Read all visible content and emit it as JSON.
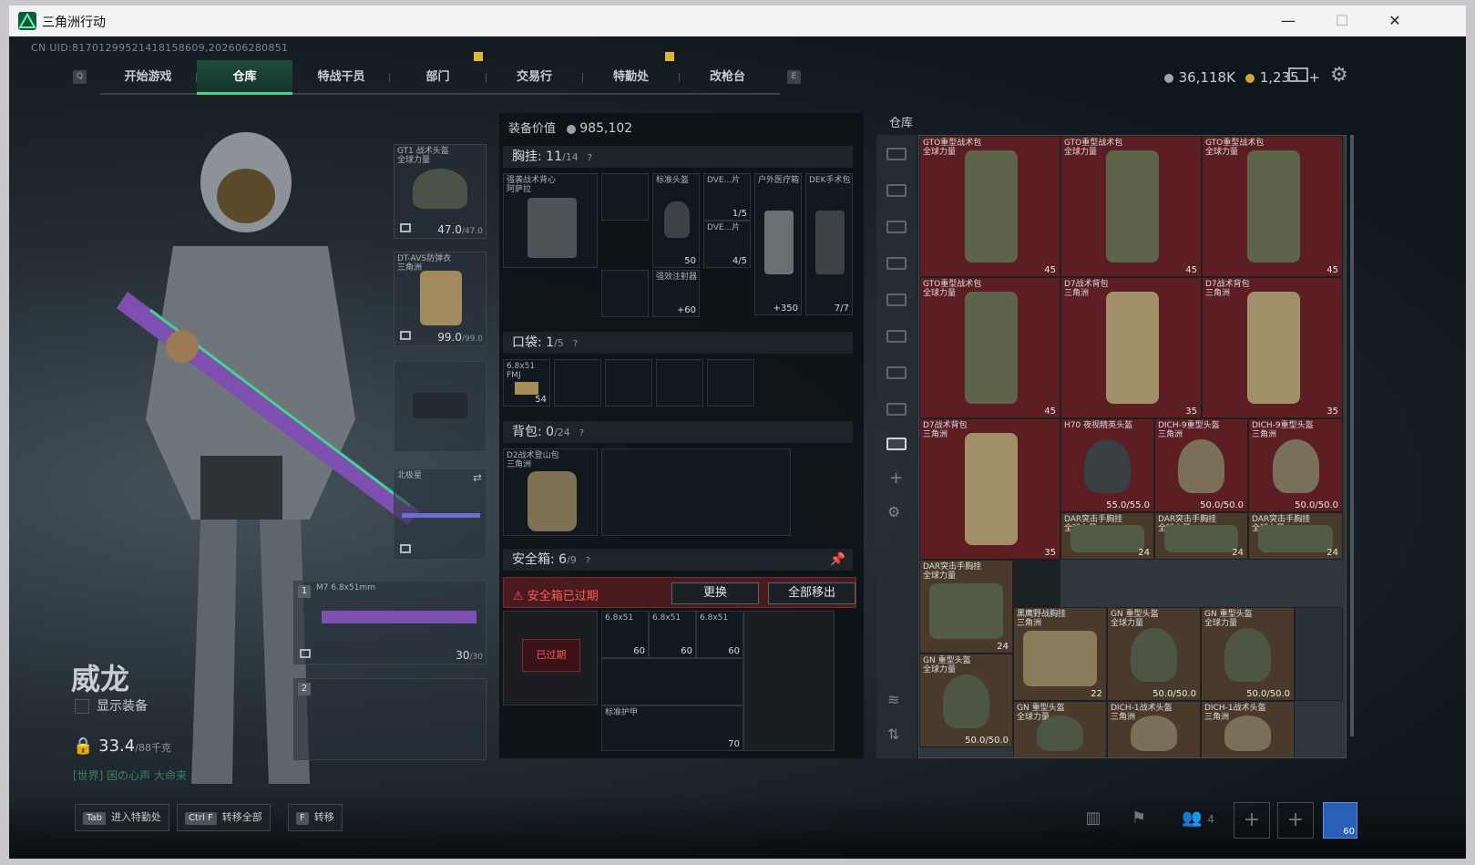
{
  "window": {
    "title": "三角洲行动",
    "btn_min": "—",
    "btn_max": "☐",
    "btn_close": "✕"
  },
  "uid": "CN UID:8170129952141815860​9,20260628085​1",
  "nav": {
    "key_left": "Q",
    "key_right": "E",
    "tabs": [
      "开始游戏",
      "仓库",
      "特战干员",
      "部门",
      "交易行",
      "特勤处",
      "改枪台"
    ],
    "active": "仓库"
  },
  "currency": {
    "silver": "36,118K",
    "gold": "1,235",
    "plus": "+"
  },
  "operator": {
    "name": "威龙",
    "show_equipment": "显示装备",
    "weight": "33.4",
    "weight_max": "/88千克",
    "world_chat": "[世界] 困の心声 大命来"
  },
  "slots": {
    "helmet": {
      "label": "GT1 战术头盔\n全球力量",
      "value": "47.0",
      "max": "/47.0"
    },
    "armor": {
      "label": "DT-AVS防弹衣\n三角洲",
      "value": "99.0",
      "max": "/99.0"
    },
    "melee": {
      "label": "北极星"
    },
    "primary": {
      "num": "1",
      "label": "M7\n6.8x51mm",
      "value": "30",
      "max": "/30"
    },
    "secondary": {
      "num": "2"
    }
  },
  "equip_value": {
    "label": "装备价值",
    "value": "985,102"
  },
  "chest_rig": {
    "label": "胸挂:",
    "count": "11",
    "max": "/14",
    "q": "?"
  },
  "chest_items": {
    "rig": "强袭战术背心\n阿萨拉",
    "helmet": "标准头盔",
    "helmet_val": "50",
    "dve1": "DVE...片",
    "dve1_val": "1/5",
    "dve2": "DVE...片",
    "dve2_val": "4/5",
    "medkit": "户外医疗箱",
    "medkit_val": "+350",
    "dek": "DEK手术包",
    "dek_val": "7/7",
    "injector": "强效注射器",
    "injector_val": "+60"
  },
  "pocket": {
    "label": "口袋:",
    "count": "1",
    "max": "/5",
    "q": "?",
    "ammo_label": "6.8x51\nFMJ",
    "ammo_val": "54"
  },
  "backpack": {
    "label": "背包:",
    "count": "0",
    "max": "/24",
    "q": "?",
    "item": "D2战术登山包\n三角洲"
  },
  "safebox": {
    "label": "安全箱:",
    "count": "6",
    "max": "/9",
    "q": "?",
    "expired": "安全箱已过期",
    "replace": "更换",
    "move_all": "全部移出",
    "expired_tag": "已过期",
    "ammo": "6.8x51",
    "ammo_val": "60",
    "vest": "标准护甲",
    "vest_val": "70"
  },
  "warehouse": {
    "title": "仓库",
    "items": [
      {
        "name": "GTO重型战术包\n全球力量",
        "count": "45"
      },
      {
        "name": "GTO重型战术包\n全球力量",
        "count": "45"
      },
      {
        "name": "GTO重型战术包\n全球力量",
        "count": "45"
      },
      {
        "name": "GTO重型战术包\n全球力量",
        "count": "45"
      },
      {
        "name": "D7战术背包\n三角洲",
        "count": "35"
      },
      {
        "name": "D7战术背包\n三角洲",
        "count": "35"
      },
      {
        "name": "D7战术背包\n三角洲",
        "count": "35"
      },
      {
        "name": "H70 夜视精英头盔",
        "count": "55.0/55.0"
      },
      {
        "name": "DICH-9重型头盔\n三角洲",
        "count": "50.0/50.0"
      },
      {
        "name": "DICH-9重型头盔\n三角洲",
        "count": "50.0/50.0"
      },
      {
        "name": "DAR突击手胸挂\n全球力量",
        "count": "24"
      },
      {
        "name": "DAR突击手胸挂\n全球力量",
        "count": "24"
      },
      {
        "name": "DAR突击手胸挂\n全球力量",
        "count": "24"
      },
      {
        "name": "DAR突击手胸挂\n全球力量",
        "count": "24"
      },
      {
        "name": "黑鹰野战胸挂\n三角洲",
        "count": "22"
      },
      {
        "name": "GN 重型头盔\n全球力量",
        "count": "50.0/50.0"
      },
      {
        "name": "GN 重型头盔\n全球力量",
        "count": "50.0/50.0"
      },
      {
        "name": "GN 重型头盔\n全球力量",
        "count": "50.0/50.0"
      },
      {
        "name": "GN 重型头盔\n全球力量",
        "count": ""
      },
      {
        "name": "DICH-1战术头盔\n三角洲",
        "count": ""
      },
      {
        "name": "DICH-1战术头盔\n三角洲",
        "count": ""
      }
    ]
  },
  "hotkeys": [
    {
      "key": "Tab",
      "label": "进入特勤处"
    },
    {
      "key": "Ctrl F",
      "label": "转移全部"
    },
    {
      "key": "F",
      "label": "转移"
    }
  ],
  "squad_count": "4",
  "avatar_level": "60",
  "colors": {
    "accent": "#46d38d",
    "warn": "#e2b43a",
    "error": "#ff5959",
    "wh_red": "#5c1e22"
  }
}
